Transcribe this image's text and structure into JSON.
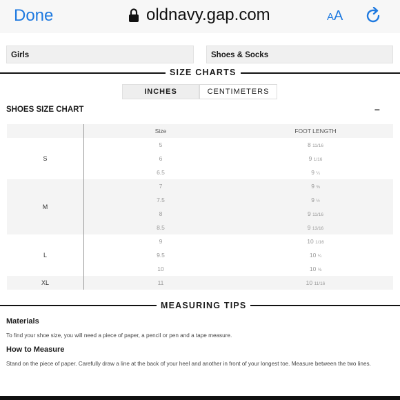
{
  "browser": {
    "done_label": "Done",
    "url": "oldnavy.gap.com",
    "aa_small": "A",
    "aa_large": "A"
  },
  "filters": {
    "category": "Girls",
    "subcategory": "Shoes & Socks"
  },
  "size_charts": {
    "title": "SIZE CHARTS",
    "units": [
      "INCHES",
      "CENTIMETERS"
    ],
    "selected_unit": "INCHES"
  },
  "shoes_chart": {
    "title": "SHOES SIZE CHART",
    "collapse_glyph": "–",
    "headers": [
      "Size",
      "FOOT LENGTH"
    ],
    "groups": [
      {
        "label": "S",
        "rows": [
          {
            "size": "5",
            "foot_whole": "8",
            "foot_frac": "11/16"
          },
          {
            "size": "6",
            "foot_whole": "9",
            "foot_frac": "1/16"
          },
          {
            "size": "6.5",
            "foot_whole": "9",
            "foot_frac": "¼"
          }
        ]
      },
      {
        "label": "M",
        "rows": [
          {
            "size": "7",
            "foot_whole": "9",
            "foot_frac": "⅜"
          },
          {
            "size": "7.5",
            "foot_whole": "9",
            "foot_frac": "½"
          },
          {
            "size": "8",
            "foot_whole": "9",
            "foot_frac": "11/16"
          },
          {
            "size": "8.5",
            "foot_whole": "9",
            "foot_frac": "13/16"
          }
        ]
      },
      {
        "label": "L",
        "rows": [
          {
            "size": "9",
            "foot_whole": "10",
            "foot_frac": "1/16"
          },
          {
            "size": "9.5",
            "foot_whole": "10",
            "foot_frac": "¼"
          },
          {
            "size": "10",
            "foot_whole": "10",
            "foot_frac": "⅜"
          }
        ]
      },
      {
        "label": "XL",
        "rows": [
          {
            "size": "11",
            "foot_whole": "10",
            "foot_frac": "11/16"
          }
        ]
      }
    ]
  },
  "measuring_tips": {
    "title": "MEASURING TIPS",
    "materials_label": "Materials",
    "materials_text": "To find your shoe size, you will need a piece of paper, a pencil or pen and a tape measure.",
    "how_label": "How to Measure",
    "how_text": "Stand on the piece of paper. Carefully draw a line at the back of your heel and another in front of your longest toe. Measure between the two lines."
  }
}
